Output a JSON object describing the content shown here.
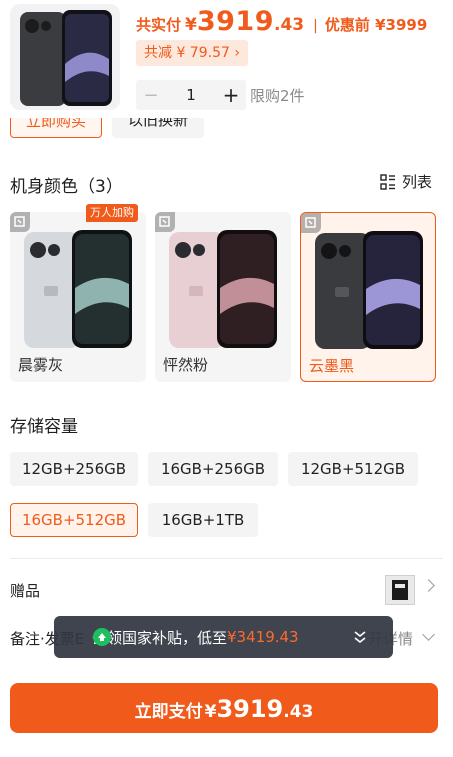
{
  "header": {
    "total_label": "共实付",
    "currency": "¥",
    "price_int": "3919",
    "price_dec": ".43",
    "separator": "|",
    "original_price": "优惠前 ¥3999",
    "discount_text": "共减 ¥ 79.57 ›",
    "quantity": "1",
    "minus_symbol": "−",
    "plus_symbol": "+",
    "limit_text": "限购2件"
  },
  "actions": {
    "buy_now": "立即购买",
    "trade_in": "以旧换新"
  },
  "color_section": {
    "title": "机身颜色（3）",
    "list_label": "列表",
    "hot_badge": "万人加购",
    "options": [
      {
        "name": "晨雾灰",
        "body": "#d9dce0",
        "selected": false
      },
      {
        "name": "怦然粉",
        "body": "#e9cfd3",
        "selected": false
      },
      {
        "name": "云墨黑",
        "body": "#3a3b3f",
        "selected": true
      }
    ]
  },
  "storage_section": {
    "title": "存储容量",
    "options": [
      {
        "label": "12GB+256GB",
        "selected": false
      },
      {
        "label": "16GB+256GB",
        "selected": false
      },
      {
        "label": "12GB+512GB",
        "selected": false
      },
      {
        "label": "16GB+512GB",
        "selected": true
      },
      {
        "label": "16GB+1TB",
        "selected": false
      }
    ]
  },
  "gift": {
    "label": "赠品"
  },
  "remark": {
    "label": "备注·发票E",
    "tail": "开详情"
  },
  "toast": {
    "text": "去领国家补贴，低至",
    "amount": "¥3419.43"
  },
  "pay_button": {
    "label": "立即支付",
    "currency": "¥",
    "price_int": "3919",
    "price_dec": ".43"
  },
  "colors": {
    "accent": "#f05a1a",
    "accent_bg": "#fff3ec",
    "toast_bg": "#303642",
    "toast_icon": "#1fbf61"
  }
}
